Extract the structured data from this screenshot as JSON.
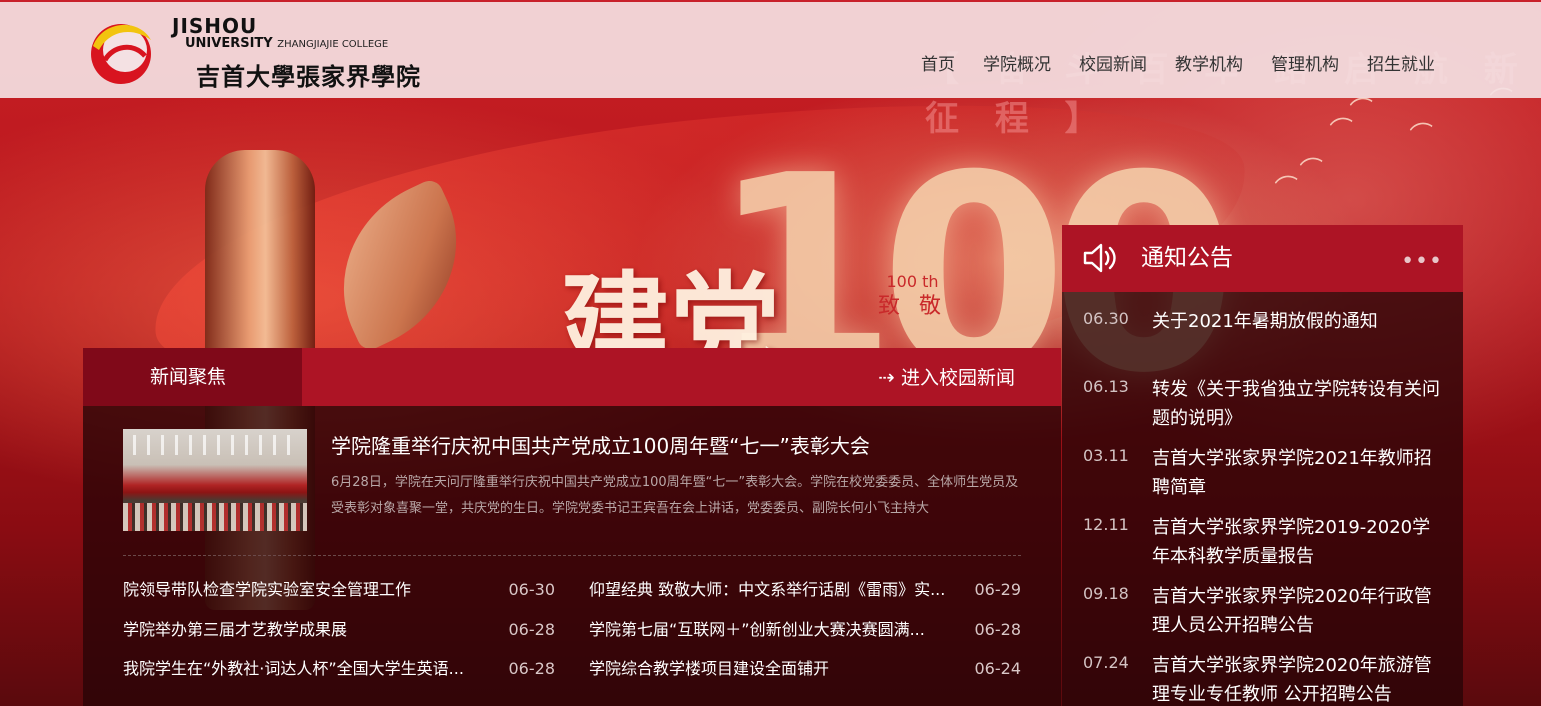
{
  "header": {
    "logo_en_line1": "JISHOU",
    "logo_en_line2": "UNIVERSITY",
    "logo_en_line2_small": "ZHANGJIAJIE COLLEGE",
    "logo_cn": "吉首大學張家界學院"
  },
  "nav": {
    "items": [
      "首页",
      "学院概况",
      "校园新闻",
      "教学机构",
      "管理机构",
      "招生就业"
    ]
  },
  "banner": {
    "slogan": "【 奋 斗 百 年 路   启 航 新 征 程 】",
    "big_number": "100",
    "calligraphy": "建党",
    "small_label": "100 th",
    "small_label2": "致 敬"
  },
  "news": {
    "tab_label": "新闻聚焦",
    "more_label": "进入校园新闻",
    "featured": {
      "title": "学院隆重举行庆祝中国共产党成立100周年暨“七一”表彰大会",
      "desc": "6月28日，学院在天问厅隆重举行庆祝中国共产党成立100周年暨“七一”表彰大会。学院在校党委委员、全体师生党员及受表彰对象喜聚一堂，共庆党的生日。学院党委书记王宾吾在会上讲话，党委委员、副院长何小飞主持大"
    },
    "items": [
      {
        "title": "院领导带队检查学院实验室安全管理工作",
        "date": "06-30"
      },
      {
        "title": "仰望经典 致敬大师：中文系举行话剧《雷雨》实...",
        "date": "06-29"
      },
      {
        "title": "学院举办第三届才艺教学成果展",
        "date": "06-28"
      },
      {
        "title": "学院第七届“互联网＋”创新创业大赛决赛圆满...",
        "date": "06-28"
      },
      {
        "title": "我院学生在“外教社·词达人杯”全国大学生英语...",
        "date": "06-28"
      },
      {
        "title": "学院综合教学楼项目建设全面铺开",
        "date": "06-24"
      }
    ]
  },
  "notice": {
    "title": "通知公告",
    "items": [
      {
        "date": "06.30",
        "title": "关于2021年暑期放假的通知"
      },
      {
        "date": "06.13",
        "title": "转发《关于我省独立学院转设有关问题的说明》"
      },
      {
        "date": "03.11",
        "title": "吉首大学张家界学院2021年教师招聘简章"
      },
      {
        "date": "12.11",
        "title": "吉首大学张家界学院2019-2020学年本科教学质量报告"
      },
      {
        "date": "09.18",
        "title": "吉首大学张家界学院2020年行政管理人员公开招聘公告"
      },
      {
        "date": "07.24",
        "title": "吉首大学张家界学院2020年旅游管理专业专任教师 公开招聘公告"
      }
    ]
  },
  "colors": {
    "brand_red": "#ad1425",
    "brand_dark_red": "#800919",
    "header_bg": "#f4e1e3"
  }
}
